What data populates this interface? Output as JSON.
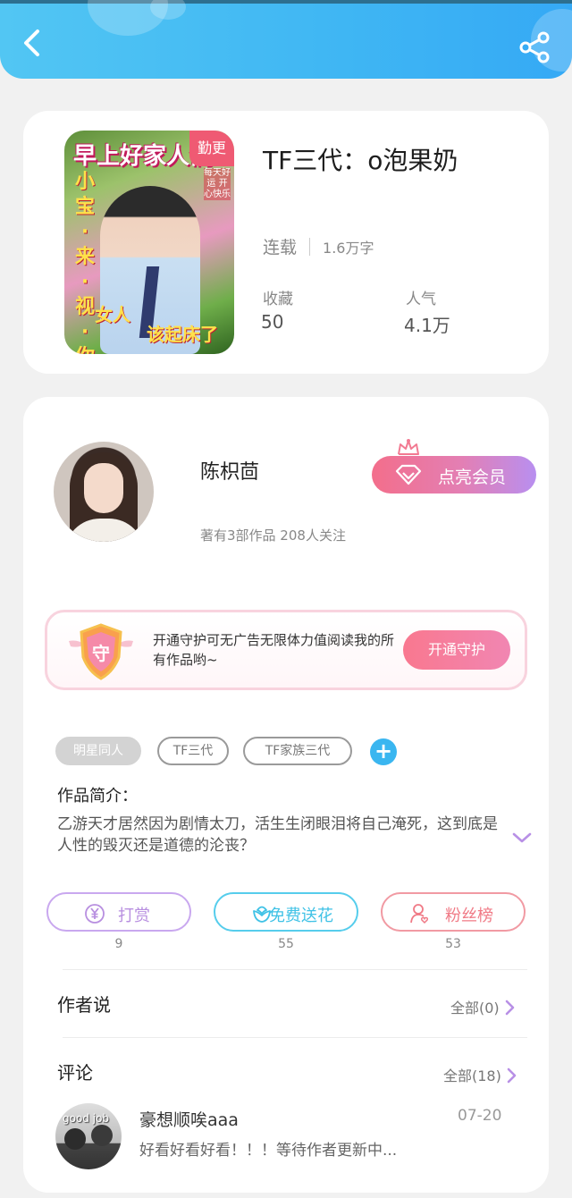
{
  "header": {
    "back_icon": "chevron-left-icon",
    "share_icon": "share-icon",
    "color": "#45b9f2"
  },
  "book": {
    "cover": {
      "badge": "勤更",
      "headline": "早上好家人们",
      "vertical_text": "小宝·来·视·你·早·安·啦",
      "caption_left": "女人",
      "caption_right": "该起床了",
      "side_text": "每天好运 开心快乐"
    },
    "title": "TF三代：o泡果奶",
    "status": "连载",
    "word_count": "1.6万字",
    "stats": [
      {
        "label": "收藏",
        "value": "50"
      },
      {
        "label": "人气",
        "value": "4.1万"
      }
    ]
  },
  "author": {
    "name": "陈枳茴",
    "meta": "著有3部作品 208人关注",
    "vip_button": "点亮会员"
  },
  "guard": {
    "shield_text": "守",
    "description": "开通守护可无广告无限体力值阅读我的所有作品哟~",
    "button": "开通守护"
  },
  "tags": [
    {
      "label": "明星同人",
      "style": "filled"
    },
    {
      "label": "TF三代",
      "style": "outline"
    },
    {
      "label": "TF家族三代",
      "style": "outline"
    }
  ],
  "intro": {
    "title": "作品简介：",
    "text": "乙游天才居然因为剧情太刀，活生生闭眼泪将自己淹死，这到底是人性的毁灭还是道德的沦丧？"
  },
  "actions": [
    {
      "label": "打赏",
      "count": "9",
      "icon": "yen-icon",
      "color": "#b88fe0"
    },
    {
      "label": "免费送花",
      "count": "55",
      "icon": "flower-icon",
      "color": "#3fc2e6"
    },
    {
      "label": "粉丝榜",
      "count": "53",
      "icon": "fans-icon",
      "color": "#f07a86"
    }
  ],
  "author_says": {
    "title": "作者说",
    "link": "全部(0)"
  },
  "comments": {
    "title": "评论",
    "link": "全部(18)",
    "items": [
      {
        "avatar_text": "good job",
        "name": "豪想顺唉aaa",
        "date": "07-20",
        "text": "好看好看好看！！！等待作者更新中..."
      }
    ]
  }
}
